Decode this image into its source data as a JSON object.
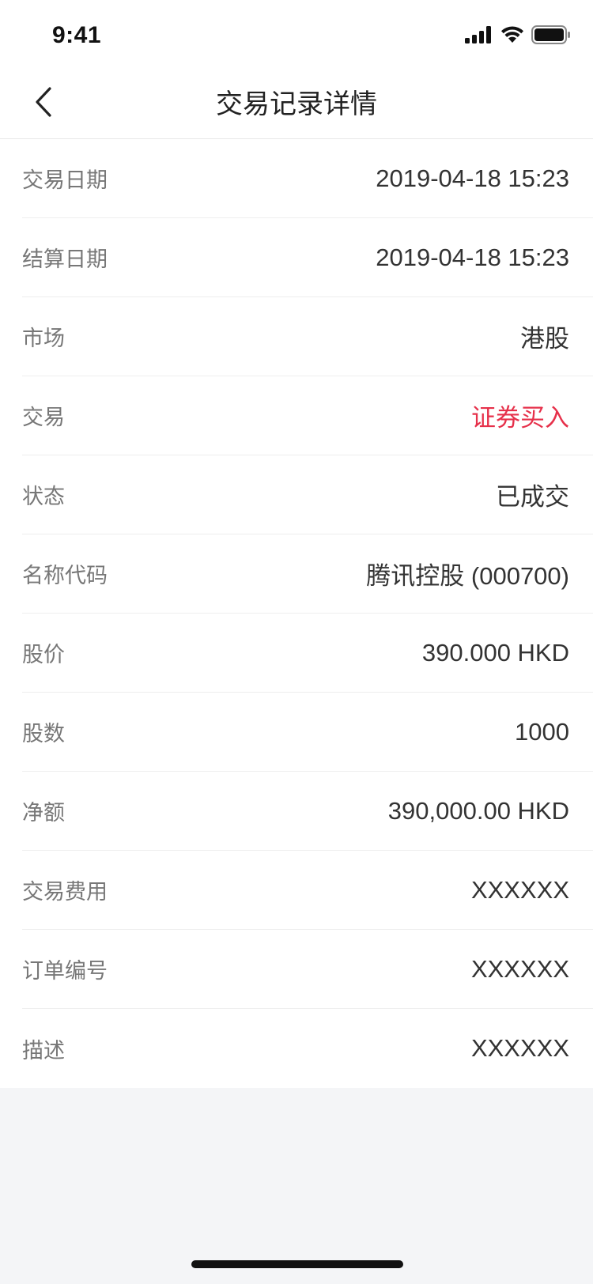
{
  "status_bar": {
    "time": "9:41",
    "signal_icon": "cellular-signal-icon",
    "wifi_icon": "wifi-icon",
    "battery_icon": "battery-icon"
  },
  "nav": {
    "back_icon": "chevron-left-icon",
    "title": "交易记录详情"
  },
  "colors": {
    "accent_red": "#e6304a",
    "label_gray": "#777777",
    "value_dark": "#333333",
    "background": "#f4f5f7"
  },
  "details": [
    {
      "label": "交易日期",
      "value": "2019-04-18 15:23"
    },
    {
      "label": "结算日期",
      "value": "2019-04-18 15:23"
    },
    {
      "label": "市场",
      "value": "港股"
    },
    {
      "label": "交易",
      "value": "证券买入"
    },
    {
      "label": "状态",
      "value": "已成交"
    },
    {
      "label": "名称代码",
      "value": "腾讯控股 (000700)"
    },
    {
      "label": "股价",
      "value": "390.000 HKD"
    },
    {
      "label": "股数",
      "value": "1000"
    },
    {
      "label": "净额",
      "value": "390,000.00 HKD"
    },
    {
      "label": "交易费用",
      "value": "XXXXXX"
    },
    {
      "label": "订单编号",
      "value": "XXXXXX"
    },
    {
      "label": "描述",
      "value": "XXXXXX"
    }
  ]
}
